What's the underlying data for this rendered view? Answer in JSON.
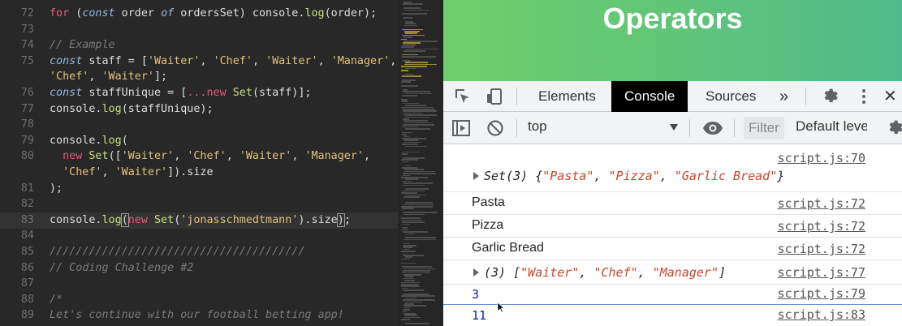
{
  "editor": {
    "lines": [
      {
        "num": "72",
        "tokens": [
          [
            "kw",
            "for"
          ],
          [
            "pl",
            " ("
          ],
          [
            "it",
            "const"
          ],
          [
            "pl",
            " order "
          ],
          [
            "it",
            "of"
          ],
          [
            "pl",
            " ordersSet) console."
          ],
          [
            "fn",
            "log"
          ],
          [
            "pl",
            "(order);"
          ]
        ]
      },
      {
        "num": "73",
        "tokens": []
      },
      {
        "num": "74",
        "tokens": [
          [
            "cm",
            "// Example"
          ]
        ]
      },
      {
        "num": "75",
        "tokens": [
          [
            "it",
            "const"
          ],
          [
            "pl",
            " staff = ["
          ],
          [
            "str",
            "'Waiter'"
          ],
          [
            "pl",
            ", "
          ],
          [
            "str",
            "'Chef'"
          ],
          [
            "pl",
            ", "
          ],
          [
            "str",
            "'Waiter'"
          ],
          [
            "pl",
            ", "
          ],
          [
            "str",
            "'Manager'"
          ],
          [
            "pl",
            ","
          ]
        ]
      },
      {
        "num": "",
        "tokens": [
          [
            "str",
            "'Chef'"
          ],
          [
            "pl",
            ", "
          ],
          [
            "str",
            "'Waiter'"
          ],
          [
            "pl",
            "];"
          ]
        ]
      },
      {
        "num": "76",
        "tokens": [
          [
            "it",
            "const"
          ],
          [
            "pl",
            " staffUnique = ["
          ],
          [
            "kw",
            "..."
          ],
          [
            "kw",
            "new"
          ],
          [
            "pl",
            " "
          ],
          [
            "fn",
            "Set"
          ],
          [
            "pl",
            "(staff)];"
          ]
        ]
      },
      {
        "num": "77",
        "tokens": [
          [
            "pl",
            "console."
          ],
          [
            "fn",
            "log"
          ],
          [
            "pl",
            "(staffUnique);"
          ]
        ]
      },
      {
        "num": "78",
        "tokens": []
      },
      {
        "num": "79",
        "tokens": [
          [
            "pl",
            "console."
          ],
          [
            "fn",
            "log"
          ],
          [
            "pl",
            "("
          ]
        ]
      },
      {
        "num": "80",
        "tokens": [
          [
            "pl",
            "  "
          ],
          [
            "kw",
            "new"
          ],
          [
            "pl",
            " "
          ],
          [
            "fn",
            "Set"
          ],
          [
            "pl",
            "(["
          ],
          [
            "str",
            "'Waiter'"
          ],
          [
            "pl",
            ", "
          ],
          [
            "str",
            "'Chef'"
          ],
          [
            "pl",
            ", "
          ],
          [
            "str",
            "'Waiter'"
          ],
          [
            "pl",
            ", "
          ],
          [
            "str",
            "'Manager'"
          ],
          [
            "pl",
            ","
          ]
        ]
      },
      {
        "num": "",
        "tokens": [
          [
            "pl",
            "  "
          ],
          [
            "str",
            "'Chef'"
          ],
          [
            "pl",
            ", "
          ],
          [
            "str",
            "'Waiter'"
          ],
          [
            "pl",
            "]).size"
          ]
        ]
      },
      {
        "num": "81",
        "tokens": [
          [
            "pl",
            ");"
          ]
        ]
      },
      {
        "num": "82",
        "tokens": []
      },
      {
        "num": "83",
        "current": true,
        "tokens": [
          [
            "pl",
            "console."
          ],
          [
            "fn",
            "log"
          ],
          [
            "br",
            "("
          ],
          [
            "kw",
            "new"
          ],
          [
            "pl",
            " "
          ],
          [
            "fn",
            "Set"
          ],
          [
            "pl",
            "("
          ],
          [
            "str",
            "'jonasschmedtmann'"
          ],
          [
            "pl",
            ").size"
          ],
          [
            "br",
            ")"
          ],
          [
            "pl",
            ";"
          ]
        ]
      },
      {
        "num": "84",
        "tokens": []
      },
      {
        "num": "85",
        "tokens": [
          [
            "cm",
            "///////////////////////////////////////"
          ]
        ]
      },
      {
        "num": "86",
        "tokens": [
          [
            "cm",
            "// Coding Challenge #2"
          ]
        ]
      },
      {
        "num": "87",
        "tokens": []
      },
      {
        "num": "88",
        "tokens": [
          [
            "cm",
            "/*"
          ]
        ]
      },
      {
        "num": "89",
        "tokens": [
          [
            "cm",
            "Let's continue with our football betting app!"
          ]
        ]
      }
    ]
  },
  "slide": {
    "title": "Operators",
    "accent": "#5fc47a"
  },
  "devtools": {
    "tabs": [
      {
        "label": "Elements",
        "active": false
      },
      {
        "label": "Console",
        "active": true
      },
      {
        "label": "Sources",
        "active": false
      }
    ],
    "more_tabs_glyph": "»",
    "icons": [
      "inspect-icon",
      "device-toolbar-icon",
      "gear-icon",
      "kebab-menu-icon",
      "close-icon",
      "sidebar-toggle-icon",
      "clear-console-icon",
      "eye-icon"
    ],
    "context": "top",
    "filter_placeholder": "Filter",
    "levels": "Default levels",
    "close_glyph": "✕"
  },
  "console": {
    "entries": [
      {
        "kind": "source-only",
        "source": "script.js:70"
      },
      {
        "kind": "object",
        "expand": true,
        "prefix": "Set(3) {",
        "items": [
          "\"Pasta\"",
          "\"Pizza\"",
          "\"Garlic Bread\""
        ],
        "suffix": "}",
        "source": ""
      },
      {
        "kind": "text",
        "text": "Pasta",
        "source": "script.js:72"
      },
      {
        "kind": "text",
        "text": "Pizza",
        "source": "script.js:72"
      },
      {
        "kind": "text",
        "text": "Garlic Bread",
        "source": "script.js:72"
      },
      {
        "kind": "object",
        "expand": true,
        "prefix": "(3) [",
        "items": [
          "\"Waiter\"",
          "\"Chef\"",
          "\"Manager\""
        ],
        "suffix": "]",
        "source": "script.js:77"
      },
      {
        "kind": "number",
        "text": "3",
        "source": "script.js:79"
      },
      {
        "kind": "number",
        "text": "11",
        "source": "script.js:83",
        "highlight": true
      }
    ]
  }
}
